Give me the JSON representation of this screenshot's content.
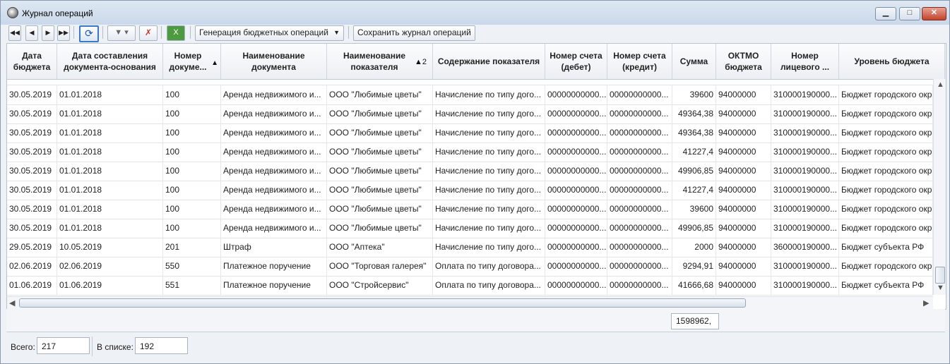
{
  "window": {
    "title": "Журнал операций"
  },
  "icons": {
    "first": "first-page-icon",
    "prev": "prev-icon",
    "next": "next-icon",
    "last": "last-page-icon",
    "refresh": "refresh-icon",
    "filter": "filter-icon",
    "clear_filter": "clear-filter-icon",
    "excel": "excel-export-icon"
  },
  "toolbar": {
    "generate_label": "Генерация бюджетных операций",
    "save_label": "Сохранить журнал операций"
  },
  "table": {
    "columns": [
      "Дата бюджета",
      "Дата составления документа-основания",
      "Номер докуме...",
      "Наименование документа",
      "Наименование показателя",
      "Содержание показателя",
      "Номер счета (дебет)",
      "Номер счета (кредит)",
      "Сумма",
      "ОКТМО бюджета",
      "Номер лицевого ...",
      "Уровень бюджета"
    ],
    "sort_marker_2": "▲2",
    "rows": [
      [
        "30.05.2019",
        "01.01.2018",
        "100",
        "Аренда недвижимого и...",
        "ООО \"Любимые цветы\"",
        "Начисление по типу дого...",
        "00000000000...",
        "00000000000...",
        "39600",
        "94000000",
        "310000190000...",
        "Бюджет городского окр"
      ],
      [
        "30.05.2019",
        "01.01.2018",
        "100",
        "Аренда недвижимого и...",
        "ООО \"Любимые цветы\"",
        "Начисление по типу дого...",
        "00000000000...",
        "00000000000...",
        "49364,38",
        "94000000",
        "310000190000...",
        "Бюджет городского окр"
      ],
      [
        "30.05.2019",
        "01.01.2018",
        "100",
        "Аренда недвижимого и...",
        "ООО \"Любимые цветы\"",
        "Начисление по типу дого...",
        "00000000000...",
        "00000000000...",
        "49364,38",
        "94000000",
        "310000190000...",
        "Бюджет городского окр"
      ],
      [
        "30.05.2019",
        "01.01.2018",
        "100",
        "Аренда недвижимого и...",
        "ООО \"Любимые цветы\"",
        "Начисление по типу дого...",
        "00000000000...",
        "00000000000...",
        "41227,4",
        "94000000",
        "310000190000...",
        "Бюджет городского окр"
      ],
      [
        "30.05.2019",
        "01.01.2018",
        "100",
        "Аренда недвижимого и...",
        "ООО \"Любимые цветы\"",
        "Начисление по типу дого...",
        "00000000000...",
        "00000000000...",
        "49906,85",
        "94000000",
        "310000190000...",
        "Бюджет городского окр"
      ],
      [
        "30.05.2019",
        "01.01.2018",
        "100",
        "Аренда недвижимого и...",
        "ООО \"Любимые цветы\"",
        "Начисление по типу дого...",
        "00000000000...",
        "00000000000...",
        "41227,4",
        "94000000",
        "310000190000...",
        "Бюджет городского окр"
      ],
      [
        "30.05.2019",
        "01.01.2018",
        "100",
        "Аренда недвижимого и...",
        "ООО \"Любимые цветы\"",
        "Начисление по типу дого...",
        "00000000000...",
        "00000000000...",
        "39600",
        "94000000",
        "310000190000...",
        "Бюджет городского окр"
      ],
      [
        "30.05.2019",
        "01.01.2018",
        "100",
        "Аренда недвижимого и...",
        "ООО \"Любимые цветы\"",
        "Начисление по типу дого...",
        "00000000000...",
        "00000000000...",
        "49906,85",
        "94000000",
        "310000190000...",
        "Бюджет городского окр"
      ],
      [
        "29.05.2019",
        "10.05.2019",
        "201",
        "Штраф",
        "ООО \"Аптека\"",
        "Начисление по типу дого...",
        "00000000000...",
        "00000000000...",
        "2000",
        "94000000",
        "360000190000...",
        "Бюджет субъекта РФ"
      ],
      [
        "02.06.2019",
        "02.06.2019",
        "550",
        "Платежное поручение",
        "ООО \"Торговая галерея\"",
        "Оплата по типу договора...",
        "00000000000...",
        "00000000000...",
        "9294,91",
        "94000000",
        "310000190000...",
        "Бюджет городского окр"
      ],
      [
        "01.06.2019",
        "01.06.2019",
        "551",
        "Платежное поручение",
        "ООО \"Стройсервис\"",
        "Оплата по типу договора...",
        "00000000000...",
        "00000000000...",
        "41666,68",
        "94000000",
        "310000190000...",
        "Бюджет субъекта РФ"
      ]
    ]
  },
  "totals": {
    "sum": "1598962,"
  },
  "status": {
    "total_label": "Всего:",
    "total_value": "217",
    "list_label": "В списке:",
    "list_value": "192"
  }
}
